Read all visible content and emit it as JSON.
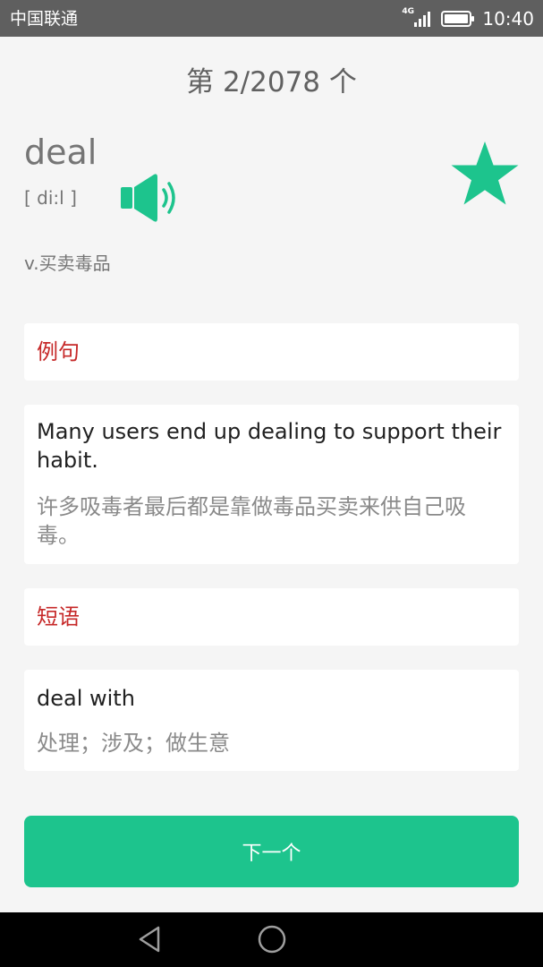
{
  "status_bar": {
    "carrier": "中国联通",
    "network": "4G",
    "time": "10:40"
  },
  "card": {
    "counter": "第 2/2078 个",
    "word": "deal",
    "phonetic": "[ di:l ]",
    "definition": "v.买卖毒品",
    "starred": true
  },
  "examples": {
    "title": "例句",
    "sentence_en": "Many users end up dealing to support their habit.",
    "sentence_zh": "许多吸毒者最后都是靠做毒品买卖来供自己吸毒。"
  },
  "phrases": {
    "title": "短语",
    "phrase_en": "deal with",
    "phrase_zh": "处理；涉及；做生意"
  },
  "next_label": "下一个",
  "colors": {
    "accent": "#1dc48d",
    "section_title": "#c62828",
    "status_bar": "#5f5f5f"
  },
  "icons": {
    "speaker": "speaker-icon",
    "star": "star-icon",
    "back": "back-icon",
    "home": "home-icon"
  }
}
